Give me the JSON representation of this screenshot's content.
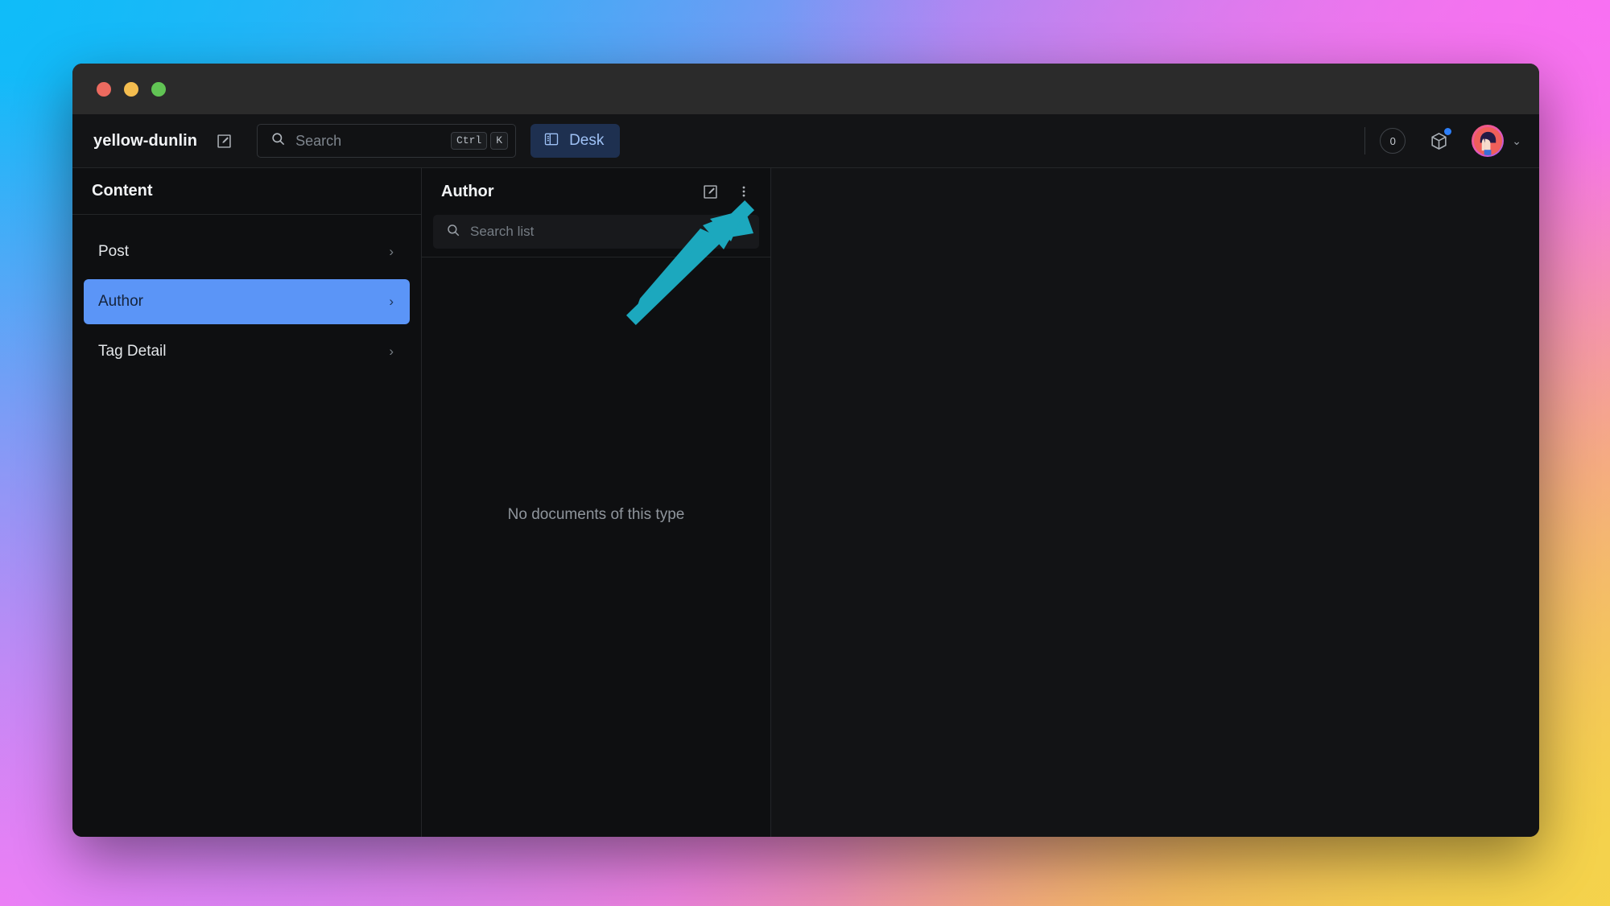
{
  "window": {
    "traffic_lights": [
      "close",
      "minimize",
      "maximize"
    ]
  },
  "toolbar": {
    "brand": "yellow-dunlin",
    "compose_icon": "edit-square-icon",
    "search": {
      "placeholder": "Search",
      "icon": "search-icon",
      "shortcut_keys": [
        "Ctrl",
        "K"
      ]
    },
    "tabs": [
      {
        "label": "Desk",
        "icon": "layout-sidebar-icon",
        "active": true
      }
    ],
    "notification_count": "0",
    "packages_icon": "cube-icon",
    "packages_has_notification": true,
    "avatar": {
      "name": "user-avatar",
      "chevron": "⌄"
    }
  },
  "sidebar": {
    "title": "Content",
    "items": [
      {
        "label": "Post",
        "chevron": "›",
        "active": false
      },
      {
        "label": "Author",
        "chevron": "›",
        "active": true
      },
      {
        "label": "Tag Detail",
        "chevron": "›",
        "active": false
      }
    ]
  },
  "list_pane": {
    "title": "Author",
    "create_icon": "edit-square-icon",
    "menu_icon": "more-vertical-icon",
    "search": {
      "placeholder": "Search list",
      "icon": "search-icon",
      "value": ""
    },
    "empty_message": "No documents of this type"
  },
  "annotation": {
    "type": "arrow",
    "color": "#1CA8BE",
    "points_to": "create-document-button"
  },
  "colors": {
    "accent_blue": "#5b95f7",
    "desk_tab_bg": "#1e3050",
    "desk_tab_text": "#9ec1f5",
    "arrow_teal": "#1CA8BE",
    "window_bg": "#101112"
  }
}
